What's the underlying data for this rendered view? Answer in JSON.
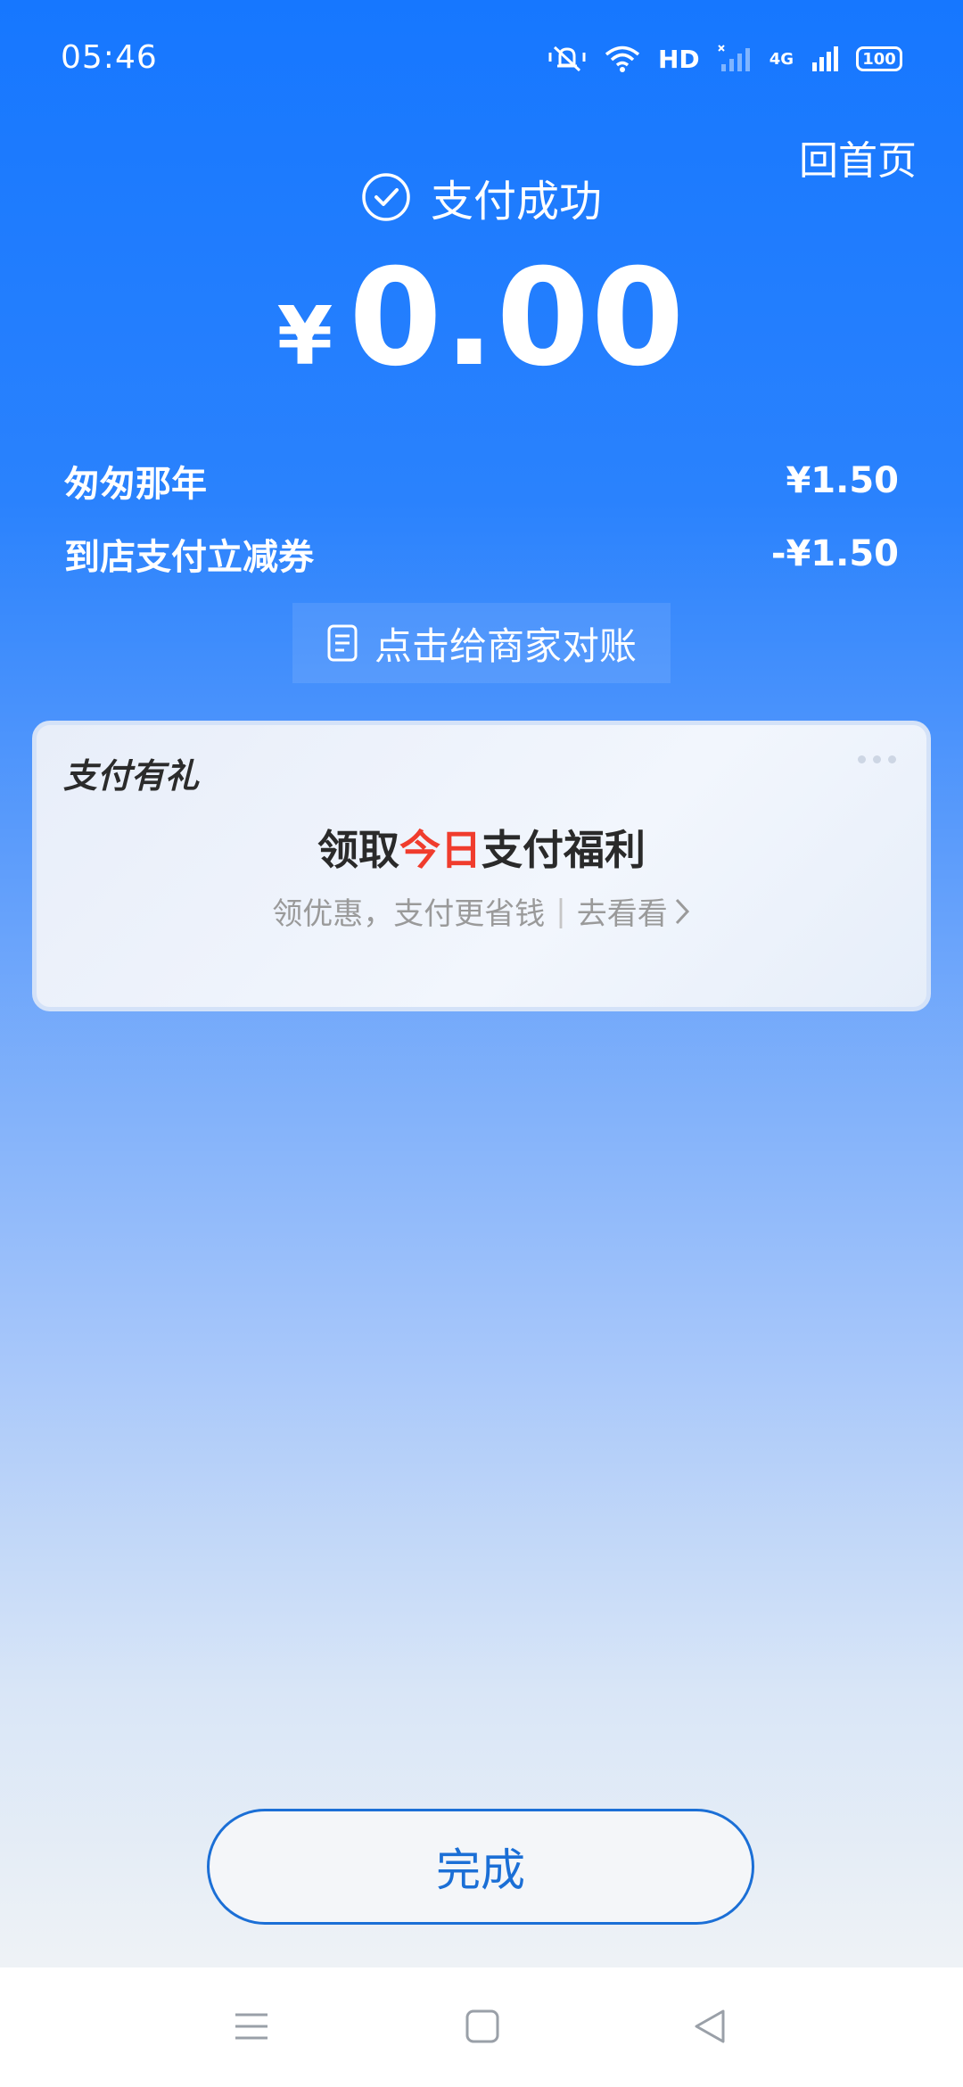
{
  "status_bar": {
    "time": "05:46",
    "network_label": "HD",
    "mobile_label": "4G",
    "battery": "100"
  },
  "header": {
    "home_link": "回首页",
    "status_text": "支付成功",
    "currency": "¥",
    "amount": "0.00"
  },
  "line_items": [
    {
      "label": "匆匆那年",
      "value": "¥1.50"
    },
    {
      "label": "到店支付立减券",
      "value": "-¥1.50"
    }
  ],
  "reconcile_button": "点击给商家对账",
  "promo_card": {
    "title": "支付有礼",
    "headline_pre": "领取",
    "headline_highlight": "今日",
    "headline_post": "支付福利",
    "sub_text": "领优惠，支付更省钱",
    "sub_separator": "|",
    "sub_link": "去看看",
    "highlight_color": "#f03c2d"
  },
  "done_button": "完成",
  "colors": {
    "primary": "#1677ff",
    "button_text": "#1b6fd6"
  },
  "icons": [
    "mute-icon",
    "wifi-icon",
    "signal-icon",
    "battery-icon",
    "check-circle-icon",
    "receipt-icon",
    "more-icon",
    "chevron-right-icon",
    "menu-icon",
    "home-icon",
    "back-icon"
  ]
}
